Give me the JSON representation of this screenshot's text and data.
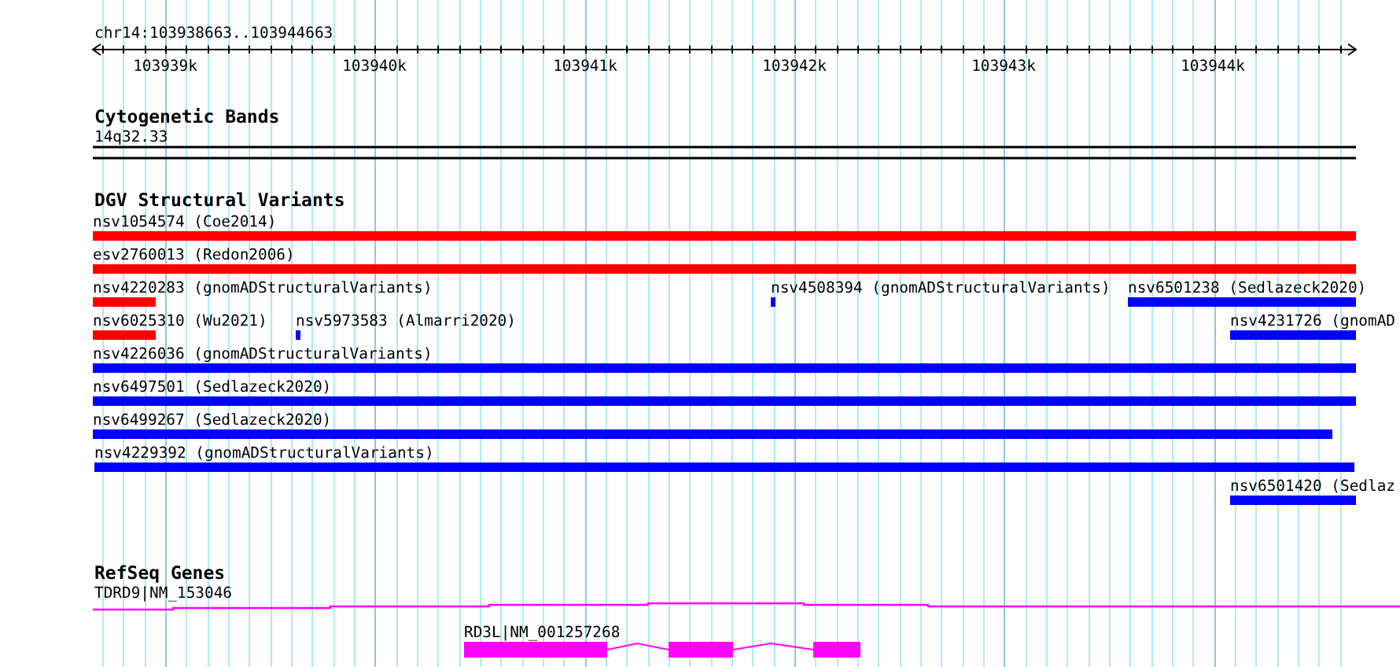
{
  "ruler": {
    "title": "chr14:103938663..103944663",
    "ticks": [
      "103939k",
      "103940k",
      "103941k",
      "103942k",
      "103943k",
      "103944k"
    ]
  },
  "cytogenetic_bands": {
    "title": "Cytogenetic Bands",
    "band": "14q32.33"
  },
  "dgv_variants": {
    "title": "DGV Structural Variants",
    "features": [
      {
        "label": "nsv1054574 (Coe2014)",
        "color": "#ff0000"
      },
      {
        "label": "esv2760013 (Redon2006)",
        "color": "#ff0000"
      },
      {
        "label": "nsv4220283 (gnomADStructuralVariants)",
        "color": "#ff0000"
      },
      {
        "label": "nsv4508394 (gnomADStructuralVariants)",
        "color": "#0000ff"
      },
      {
        "label": "nsv6501238 (Sedlazeck2020)",
        "color": "#0000ff"
      },
      {
        "label": "nsv6025310 (Wu2021)",
        "color": "#ff0000"
      },
      {
        "label": "nsv5973583 (Almarri2020)",
        "color": "#0000ff"
      },
      {
        "label": "nsv4231726 (gnomAD",
        "color": "#0000ff"
      },
      {
        "label": "nsv4226036 (gnomADStructuralVariants)",
        "color": "#0000ff"
      },
      {
        "label": "nsv6497501 (Sedlazeck2020)",
        "color": "#0000ff"
      },
      {
        "label": "nsv6499267 (Sedlazeck2020)",
        "color": "#0000ff"
      },
      {
        "label": "nsv4229392 (gnomADStructuralVariants)",
        "color": "#0000ff"
      },
      {
        "label": "nsv6501420 (Sedlaz",
        "color": "#0000ff"
      }
    ]
  },
  "refseq_genes": {
    "title": "RefSeq Genes",
    "genes": [
      {
        "label": "TDRD9|NM_153046"
      },
      {
        "label": "RD3L|NM_001257268"
      }
    ]
  }
}
